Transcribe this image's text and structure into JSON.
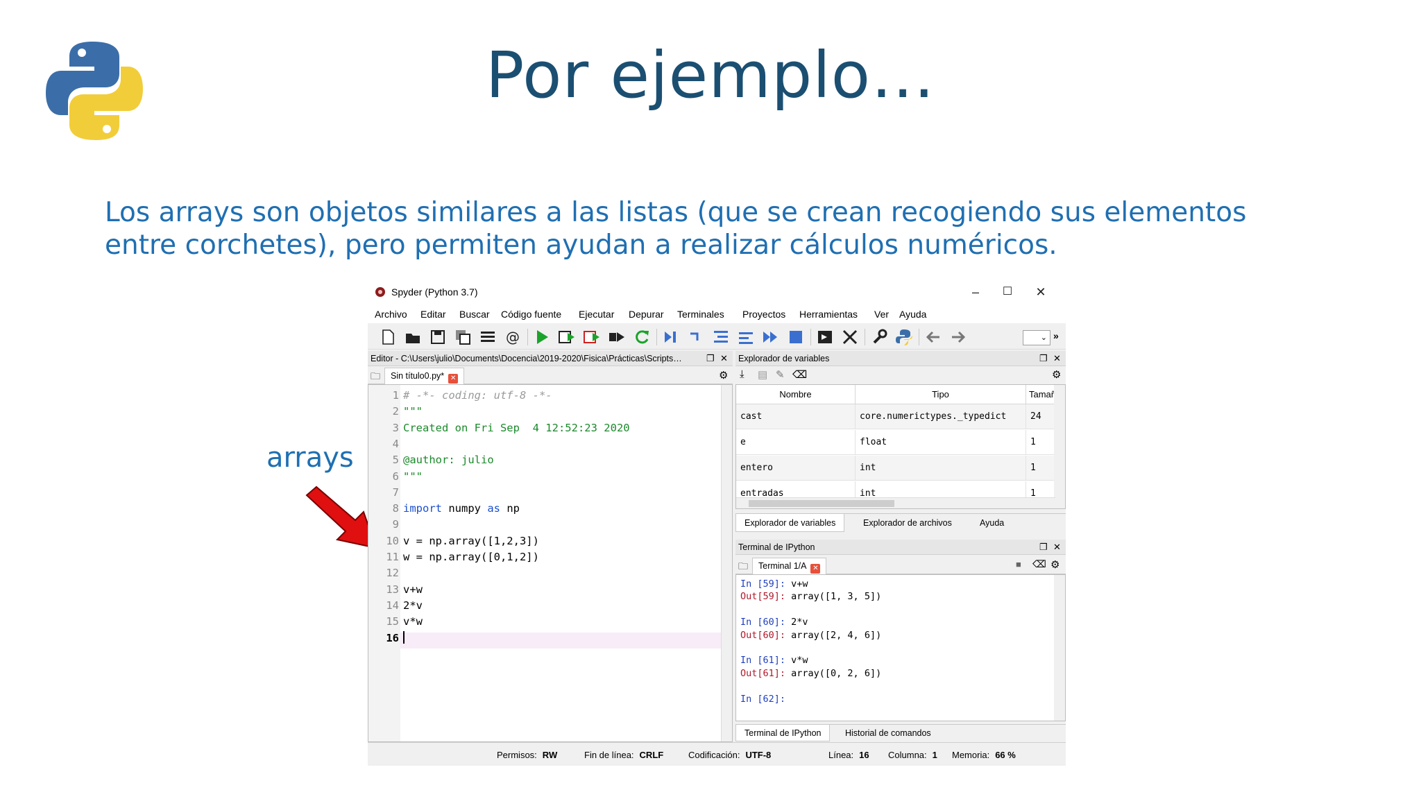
{
  "slide": {
    "title": "Por ejemplo…",
    "body": "Los arrays son objetos similares a las listas (que se crean recogiendo sus elementos entre corchetes), pero permiten ayudan a realizar cálculos numéricos.",
    "annotation": "arrays"
  },
  "window": {
    "title": "Spyder (Python 3.7)",
    "controls": {
      "minimize": "–",
      "maximize": "☐",
      "close": "✕"
    }
  },
  "menu": [
    "Archivo",
    "Editar",
    "Buscar",
    "Código fuente",
    "Ejecutar",
    "Depurar",
    "Terminales",
    "Proyectos",
    "Herramientas",
    "Ver",
    "Ayuda"
  ],
  "editor": {
    "header": "Editor - C:\\Users\\julio\\Documents\\Docencia\\2019-2020\\Fisica\\Prácticas\\Scripts…",
    "tab": "Sin título0.py*",
    "lines": [
      {
        "n": "1",
        "text": "# -*- coding: utf-8 -*-",
        "style": "comment"
      },
      {
        "n": "2",
        "text": "\"\"\"",
        "style": "string"
      },
      {
        "n": "3",
        "text": "Created on Fri Sep  4 12:52:23 2020",
        "style": "string"
      },
      {
        "n": "4",
        "text": "",
        "style": "string"
      },
      {
        "n": "5",
        "text": "@author: julio",
        "style": "string"
      },
      {
        "n": "6",
        "text": "\"\"\"",
        "style": "string"
      },
      {
        "n": "7",
        "text": "",
        "style": "plain"
      },
      {
        "n": "8",
        "text": "import numpy as np",
        "style": "import"
      },
      {
        "n": "9",
        "text": "",
        "style": "plain"
      },
      {
        "n": "10",
        "text": "v = np.array([1,2,3])",
        "style": "plain"
      },
      {
        "n": "11",
        "text": "w = np.array([0,1,2])",
        "style": "plain"
      },
      {
        "n": "12",
        "text": "",
        "style": "plain"
      },
      {
        "n": "13",
        "text": "v+w",
        "style": "plain"
      },
      {
        "n": "14",
        "text": "2*v",
        "style": "plain"
      },
      {
        "n": "15",
        "text": "v*w",
        "style": "plain"
      },
      {
        "n": "16",
        "text": "",
        "style": "current"
      }
    ]
  },
  "variable_explorer": {
    "header": "Explorador de variables",
    "columns": [
      "Nombre",
      "Tipo",
      "Tamaño"
    ],
    "rows": [
      {
        "name": "cast",
        "type": "core.numerictypes._typedict",
        "size": "24"
      },
      {
        "name": "e",
        "type": "float",
        "size": "1"
      },
      {
        "name": "entero",
        "type": "int",
        "size": "1"
      },
      {
        "name": "entradas",
        "type": "int",
        "size": "1"
      }
    ],
    "tabs": [
      "Explorador de variables",
      "Explorador de archivos",
      "Ayuda"
    ]
  },
  "terminal": {
    "header": "Terminal de IPython",
    "tab": "Terminal 1/A",
    "lines": [
      {
        "kind": "in",
        "prompt": "In [59]: ",
        "text": "v+w"
      },
      {
        "kind": "out",
        "prompt": "Out[59]: ",
        "text": "array([1, 3, 5])"
      },
      {
        "kind": "blank",
        "prompt": "",
        "text": ""
      },
      {
        "kind": "in",
        "prompt": "In [60]: ",
        "text": "2*v"
      },
      {
        "kind": "out",
        "prompt": "Out[60]: ",
        "text": "array([2, 4, 6])"
      },
      {
        "kind": "blank",
        "prompt": "",
        "text": ""
      },
      {
        "kind": "in",
        "prompt": "In [61]: ",
        "text": "v*w"
      },
      {
        "kind": "out",
        "prompt": "Out[61]: ",
        "text": "array([0, 2, 6])"
      },
      {
        "kind": "blank",
        "prompt": "",
        "text": ""
      },
      {
        "kind": "in",
        "prompt": "In [62]: ",
        "text": ""
      }
    ],
    "bottom_tabs": [
      "Terminal de IPython",
      "Historial de comandos"
    ]
  },
  "status": {
    "permisos_label": "Permisos:",
    "permisos": "RW",
    "eol_label": "Fin de línea:",
    "eol": "CRLF",
    "encoding_label": "Codificación:",
    "encoding": "UTF-8",
    "line_label": "Línea:",
    "line": "16",
    "col_label": "Columna:",
    "col": "1",
    "mem_label": "Memoria:",
    "mem": "66 %"
  },
  "colors": {
    "title": "#1b4f72",
    "body": "#1f6fb2",
    "arrow": "#e01010"
  }
}
